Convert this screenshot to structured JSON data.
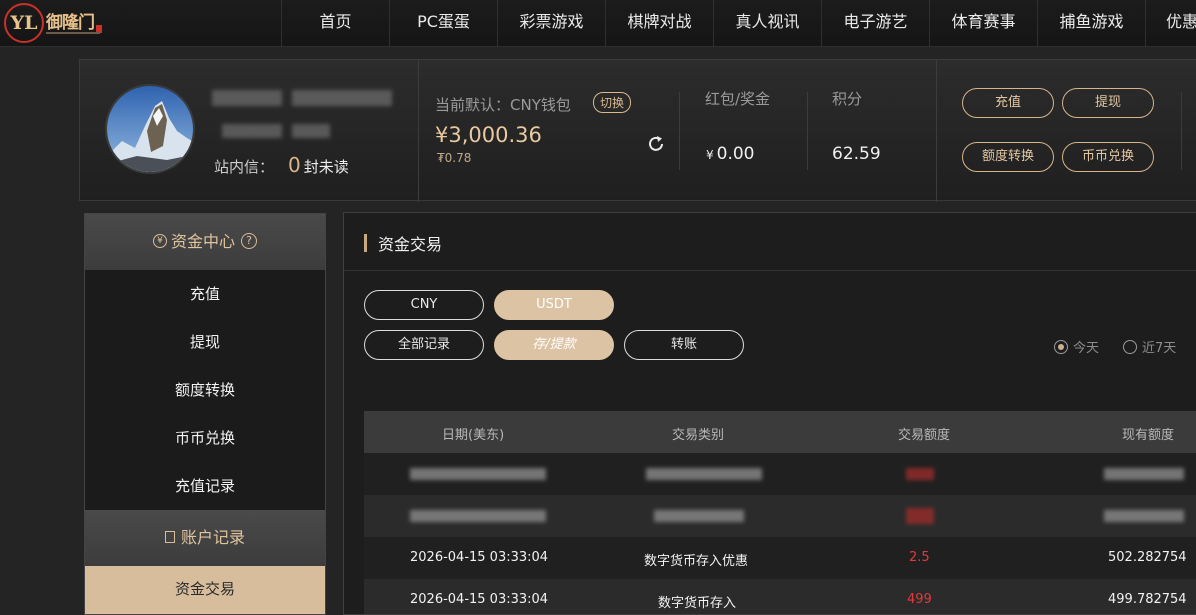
{
  "brand": {
    "logo_mark": "YL",
    "name": "御隆门"
  },
  "nav": [
    "首页",
    "PC蛋蛋",
    "彩票游戏",
    "棋牌对战",
    "真人视讯",
    "电子游艺",
    "体育赛事",
    "捕鱼游戏",
    "优惠"
  ],
  "user": {
    "msg_label": "站内信：",
    "msg_count": "0",
    "msg_unit": "封未读"
  },
  "wallet": {
    "default_label": "当前默认：CNY钱包",
    "switch_label": "切换",
    "balance": "¥3,000.36",
    "sub_balance": "₮0.78"
  },
  "bonus": {
    "label": "红包/奖金",
    "currency": "¥",
    "value": "0.00"
  },
  "points": {
    "label": "积分",
    "value": "62.59"
  },
  "actions": {
    "deposit": "充值",
    "withdraw": "提现",
    "transfer_quota": "额度转换",
    "coin_exchange": "币币兑换"
  },
  "sidebar": {
    "section1_title": "资金中心",
    "section1_items": [
      "充值",
      "提现",
      "额度转换",
      "币币兑换",
      "充值记录"
    ],
    "section2_title": "账户记录",
    "section2_items": [
      "资金交易"
    ]
  },
  "main": {
    "title": "资金交易",
    "currency_tabs": [
      "CNY",
      "USDT"
    ],
    "type_tabs": [
      "全部记录",
      "存/提款",
      "转账"
    ],
    "range_options": [
      "今天",
      "近7天"
    ],
    "table": {
      "headers": [
        "日期(美东)",
        "交易类别",
        "交易额度",
        "现有额度"
      ],
      "rows": [
        {
          "date": "2026-04-15 03:33:04",
          "type": "数字货币存入优惠",
          "amount": "2.5",
          "balance": "502.282754"
        },
        {
          "date": "2026-04-15 03:33:04",
          "type": "数字货币存入",
          "amount": "499",
          "balance": "499.782754"
        }
      ]
    }
  },
  "colors": {
    "accent": "#d7bd9c",
    "amount_red": "#e23a3a",
    "background": "#242424"
  }
}
